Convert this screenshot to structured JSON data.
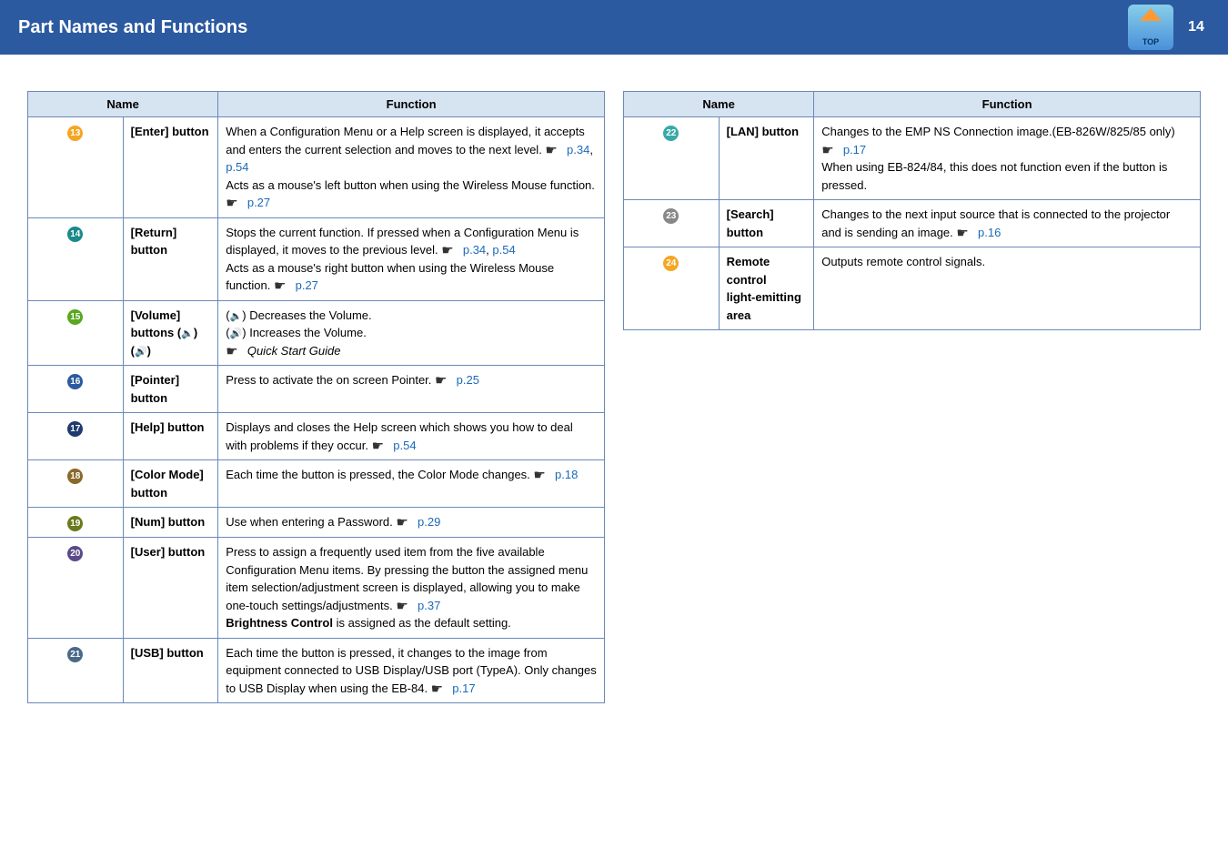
{
  "header": {
    "title": "Part Names and Functions",
    "top_label": "TOP",
    "page_number": "14"
  },
  "table1": {
    "head_name": "Name",
    "head_function": "Function",
    "rows": [
      {
        "num": "13",
        "name": "[Enter] button",
        "func_a": "When a Configuration Menu or a Help screen is displayed, it accepts and enters the current selection and moves to the next level. ",
        "link1": "p.34",
        "sep1": ", ",
        "link2": "p.54",
        "func_b": "Acts as a mouse's left button when using the Wireless Mouse function. ",
        "link3": "p.27"
      },
      {
        "num": "14",
        "name": "[Return] button",
        "func_a": "Stops the current function. If pressed when a Configuration Menu is displayed, it moves to the previous level. ",
        "link1": "p.34",
        "sep1": ", ",
        "link2": "p.54",
        "func_b": "Acts as a mouse's right button when using the Wireless Mouse function. ",
        "link3": "p.27"
      },
      {
        "num": "15",
        "name_a": "[Volume] buttons (",
        "name_b": ")",
        "name_c": "(",
        "name_d": ")",
        "func_dec": ") Decreases the Volume.",
        "func_inc": ") Increases the Volume.",
        "func_guide": "Quick Start Guide"
      },
      {
        "num": "16",
        "name": "[Pointer] button",
        "func_a": "Press to activate the on screen Pointer. ",
        "link1": "p.25"
      },
      {
        "num": "17",
        "name": "[Help] button",
        "func_a": "Displays and closes the Help screen which shows you how to deal with problems if they occur. ",
        "link1": "p.54"
      },
      {
        "num": "18",
        "name": "[Color Mode] button",
        "func_a": "Each time the button is pressed, the Color Mode changes. ",
        "link1": "p.18"
      },
      {
        "num": "19",
        "name": "[Num] button",
        "func_a": "Use when entering a Password. ",
        "link1": "p.29"
      },
      {
        "num": "20",
        "name": "[User] button",
        "func_a": "Press to assign a frequently used item from the five available Configuration Menu items. By pressing the button the assigned menu item selection/adjustment screen is displayed, allowing you to make one-touch settings/adjustments. ",
        "link1": "p.37",
        "bold1": "Brightness Control",
        "func_b": " is assigned as the default setting."
      },
      {
        "num": "21",
        "name": "[USB] button",
        "func_a": "Each time the button is pressed, it changes to the image from equipment connected to USB Display/USB port (TypeA). Only changes to USB Display when using the EB-84. ",
        "link1": "p.17"
      }
    ]
  },
  "table2": {
    "head_name": "Name",
    "head_function": "Function",
    "rows": [
      {
        "num": "22",
        "name": "[LAN] button",
        "func_a": "Changes to the EMP NS Connection image.(EB-826W/825/85 only) ",
        "link1": "p.17",
        "func_b": "When using EB-824/84, this does not function even if the button is pressed."
      },
      {
        "num": "23",
        "name": "[Search] button",
        "func_a": "Changes to the next input source that is connected to the projector and is sending an image. ",
        "link1": "p.16"
      },
      {
        "num": "24",
        "name_a": "Remote control",
        "name_b": "light-emitting area",
        "func_a": "Outputs remote control signals."
      }
    ]
  }
}
